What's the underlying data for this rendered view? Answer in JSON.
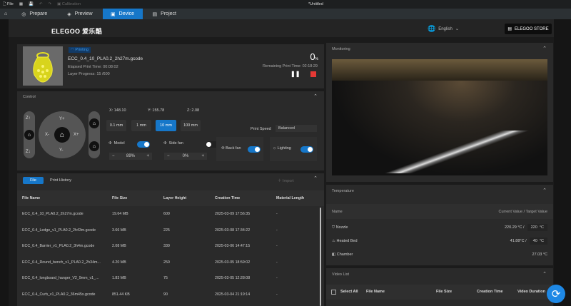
{
  "topbar": {
    "file": "File",
    "calibration": "Calibration",
    "doc_title": "*Untitled"
  },
  "tabs": [
    {
      "label": "Prepare"
    },
    {
      "label": "Preview"
    },
    {
      "label": "Device"
    },
    {
      "label": "Project"
    }
  ],
  "header": {
    "logo": "ELEGOO 爱乐酷",
    "language": "English",
    "store": "ELEGOO STORE"
  },
  "print": {
    "status": "Printing",
    "file": "ECC_0.4_10_PLA0.2_2h27m.gcode",
    "elapsed_label": "Elapsed Print Time:",
    "elapsed": "00:08:02",
    "layer_label": "Layer Progress:",
    "layer": "15 /600",
    "percent": "0",
    "percent_unit": "%",
    "remaining_label": "Remaining Print Time:",
    "remaining": "02:18:29"
  },
  "control": {
    "title": "Control",
    "z_up": "Z↑",
    "z_down": "Z↓",
    "y_plus": "Y+",
    "y_minus": "Y-",
    "x_minus": "X-",
    "x_plus": "X+",
    "x": "X:  148.10",
    "y": "Y:  155.78",
    "z": "Z:  2.08",
    "steps": [
      "0.1 mm",
      "1 mm",
      "10 mm",
      "100 mm"
    ],
    "active_step": "10 mm",
    "print_speed_label": "Print Speed",
    "print_speed": "Balanced",
    "model_fan": "Model",
    "model_fan_on": true,
    "model_value": "89%",
    "side_fan": "Side fan",
    "side_fan_on": false,
    "side_value": "0%",
    "back_fan": "Back fan",
    "back_fan_on": true,
    "lighting": "Lighting",
    "lighting_on": true
  },
  "files": {
    "tab_file": "File",
    "tab_history": "Print History",
    "import": "Import",
    "columns": [
      "File Name",
      "File Size",
      "Layer Height",
      "Creation Time",
      "Material Length"
    ],
    "rows": [
      [
        "ECC_0.4_10_PLA0.2_2h27m.gcode",
        "19.64 MB",
        "600",
        "2025-03-09 17:56:35",
        "-"
      ],
      [
        "ECC_0.4_Ledge_v1_PLA0.2_2h43m.gcode",
        "3.66 MB",
        "225",
        "2025-03-08 17:34:22",
        "-"
      ],
      [
        "ECC_0.4_Barrier_v1_PLA0.2_3h4m.gcode",
        "2.08 MB",
        "330",
        "2025-03-06 14:47:15",
        "-"
      ],
      [
        "ECC_0.4_Round_bench_v1_PLA0.2_2h34m...",
        "4.20 MB",
        "250",
        "2025-03-05 18:59:02",
        "-"
      ],
      [
        "ECC_0.4_longboard_hanger_V2_9mm_v1_...",
        "1.83 MB",
        "75",
        "2025-03-05 12:28:08",
        "-"
      ],
      [
        "ECC_0.4_Curb_v1_PLA0.2_36m45s.gcode",
        "851.44 KB",
        "90",
        "2025-03-04 21:19:14",
        "-"
      ]
    ]
  },
  "monitoring": {
    "title": "Monitoring"
  },
  "temperature": {
    "title": "Temperature",
    "col_name": "Name",
    "col_value": "Current Value / Target Value",
    "nozzle": {
      "label": "Nozzle",
      "current": "220.29 °C  /",
      "target": "220",
      "unit": "°C"
    },
    "bed": {
      "label": "Heated Bed",
      "current": "41.88°C  /",
      "target": "40",
      "unit": "°C"
    },
    "chamber": {
      "label": "Chamber",
      "current": "27.03 °C"
    }
  },
  "video": {
    "title": "Video List",
    "select_all": "Select All",
    "columns": [
      "File Name",
      "File Size",
      "Creation Time",
      "Video Duration"
    ]
  },
  "colors": {
    "accent": "#1677c9",
    "stop": "#e53935",
    "model": "#e6e020"
  }
}
